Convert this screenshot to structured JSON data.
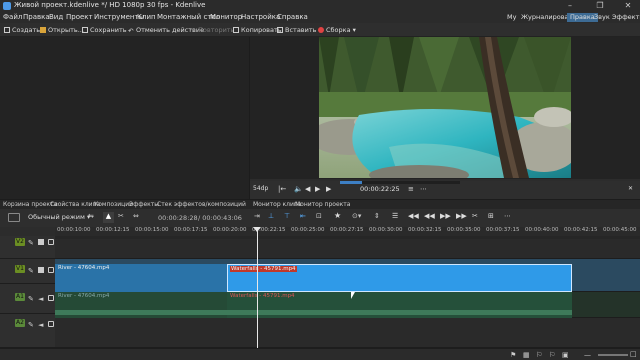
{
  "window": {
    "title": "Живой проект.kdenlive */ HD 1080p 30 fps - Kdenlive"
  },
  "menu": {
    "items": [
      "Файл",
      "Правка",
      "Вид",
      "Проект",
      "Инструменты",
      "Клип",
      "Монтажный стол",
      "Монитор",
      "Настройка",
      "Справка"
    ]
  },
  "workspaces": [
    "Му",
    "Журналирование",
    "Правка",
    "Звук",
    "Эффекты"
  ],
  "active_workspace": "Правка",
  "toolbar": {
    "create": "Создать",
    "open": "Открыть...",
    "save": "Сохранить",
    "undo": "Отменить действие",
    "redo": "Повторить",
    "copy": "Копировать",
    "paste": "Вставить",
    "render": "Сборка"
  },
  "monitor": {
    "zoom": "54dp",
    "timecode": "00:00:22:25"
  },
  "tabs": {
    "project_bin": "Корзина проекта",
    "clip_props": "Свойства клипа",
    "compositions": "Композиции",
    "effects": "Эффекты",
    "effect_stack": "Стек эффектов/композиций",
    "clip_monitor": "Монитор клипа",
    "project_monitor": "Монитор проекта"
  },
  "timeline_toolbar": {
    "mode": "Обычный режим",
    "position": "00:00:28:28",
    "duration": "/ 00:00:43:06"
  },
  "ruler": [
    "00:00:10:00",
    "00:00:12:15",
    "00:00:15:00",
    "00:00:17:15",
    "00:00:20:00",
    "00:00:22:15",
    "00:00:25:00",
    "00:00:27:15",
    "00:00:30:00",
    "00:00:32:15",
    "00:00:35:00",
    "00:00:37:15",
    "00:00:40:00",
    "00:00:42:15",
    "00:00:45:00"
  ],
  "tracks": {
    "v2": "V2",
    "v1": "V1",
    "a1": "A1",
    "a2": "A2"
  },
  "clips": {
    "river_video": "River - 47604.mp4",
    "waterfalls_video": "Waterfalls - 45791.mp4",
    "river_audio": "River - 47604.mp4",
    "waterfalls_audio": "Waterfalls - 45791.mp4"
  },
  "colors": {
    "video_clip": "#2a73a8",
    "selected_clip": "#2f9ae8",
    "audio_clip": "#254a36",
    "label_red": "#c0392b",
    "accent": "#3d6b94"
  }
}
